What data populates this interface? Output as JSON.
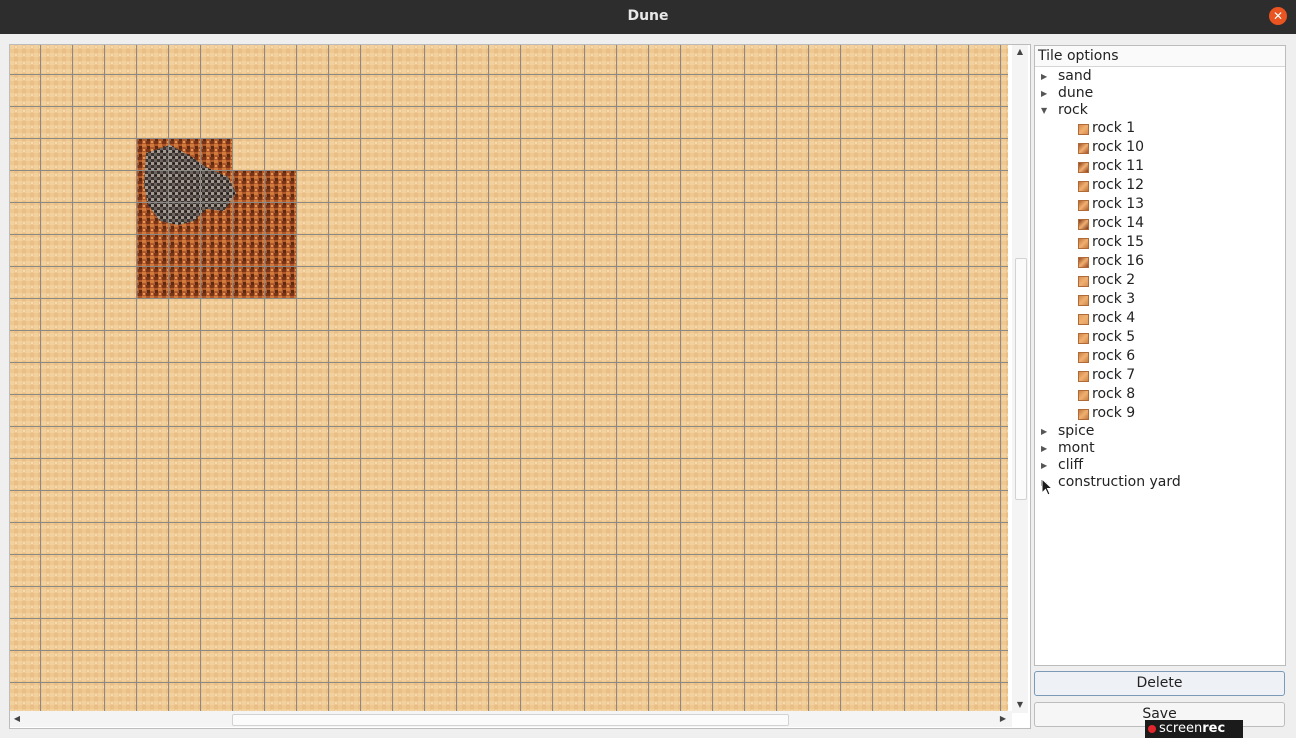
{
  "window": {
    "title": "Dune"
  },
  "tree": {
    "header": "Tile options",
    "groups": [
      {
        "label": "sand",
        "expanded": false
      },
      {
        "label": "dune",
        "expanded": false
      },
      {
        "label": "rock",
        "expanded": true,
        "children": [
          "rock 1",
          "rock 10",
          "rock 11",
          "rock 12",
          "rock 13",
          "rock 14",
          "rock 15",
          "rock 16",
          "rock 2",
          "rock 3",
          "rock 4",
          "rock 5",
          "rock 6",
          "rock 7",
          "rock 8",
          "rock 9"
        ]
      },
      {
        "label": "spice",
        "expanded": false
      },
      {
        "label": "mont",
        "expanded": false
      },
      {
        "label": "cliff",
        "expanded": false
      },
      {
        "label": "construction yard",
        "expanded": false
      }
    ]
  },
  "buttons": {
    "delete": "Delete",
    "save": "Save"
  },
  "watermark": {
    "text_a": "screen",
    "text_b": "rec"
  },
  "colors": {
    "sand": "#efc891",
    "grid": "#8a8a86",
    "rock": "#b0582a",
    "accent": "#e95420"
  },
  "icons": {
    "close": "close-icon",
    "collapsed": "triangle-right-icon",
    "expanded": "triangle-down-icon"
  }
}
